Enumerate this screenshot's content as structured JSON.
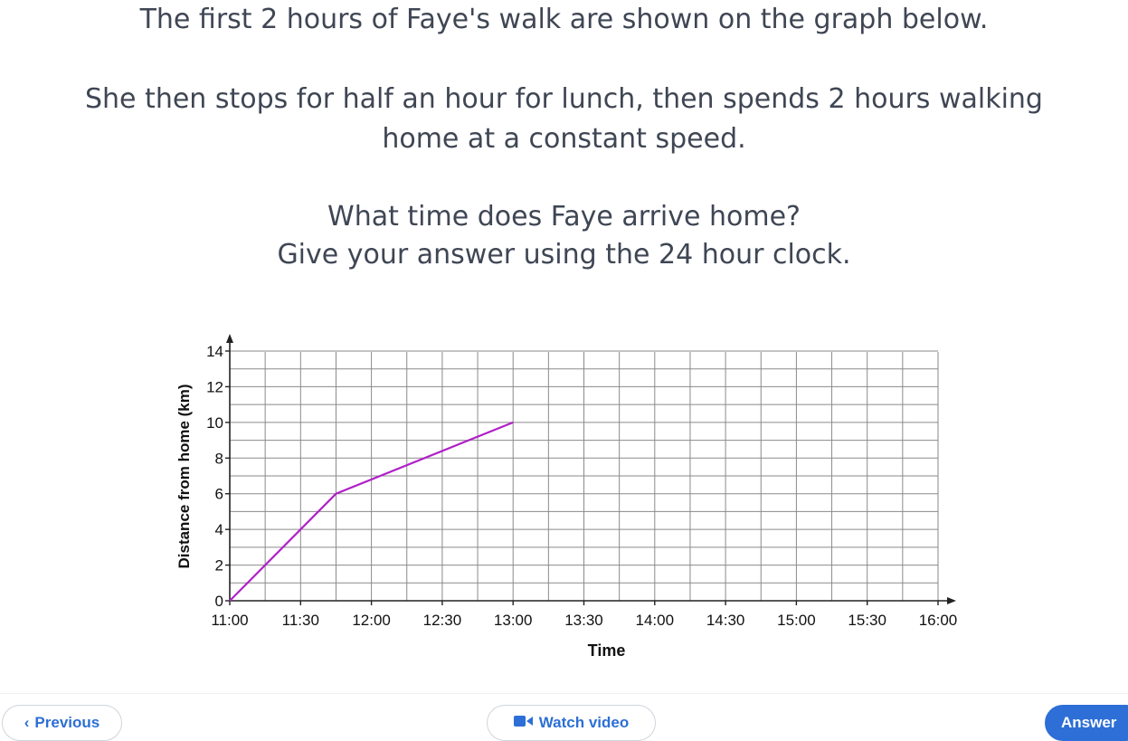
{
  "question": {
    "line1": "The first 2 hours of Faye's walk are shown on the graph below.",
    "line2": "She then stops for half an hour for lunch, then spends 2 hours walking",
    "line3": "home at a constant speed.",
    "line4": "What time does Faye arrive home?",
    "line5": "Give your answer using the 24 hour clock."
  },
  "chart_data": {
    "type": "line",
    "xlabel": "Time",
    "ylabel": "Distance from home (km)",
    "x_tick_labels": [
      "11:00",
      "11:30",
      "12:00",
      "12:30",
      "13:00",
      "13:30",
      "14:00",
      "14:30",
      "15:00",
      "15:30",
      "16:00"
    ],
    "y_tick_labels": [
      "0",
      "2",
      "4",
      "6",
      "8",
      "10",
      "12",
      "14"
    ],
    "xlim_hours": [
      11,
      16
    ],
    "ylim": [
      0,
      14
    ],
    "grid": true,
    "series": [
      {
        "color": "#b020c8",
        "x": [
          "11:00",
          "11:45",
          "13:00"
        ],
        "y": [
          0,
          6,
          10
        ]
      }
    ]
  },
  "footer": {
    "previous_label": "Previous",
    "video_label": "Watch video",
    "answer_label": "Answer"
  },
  "colors": {
    "accent": "#2d6fd6",
    "line": "#b020c8"
  }
}
